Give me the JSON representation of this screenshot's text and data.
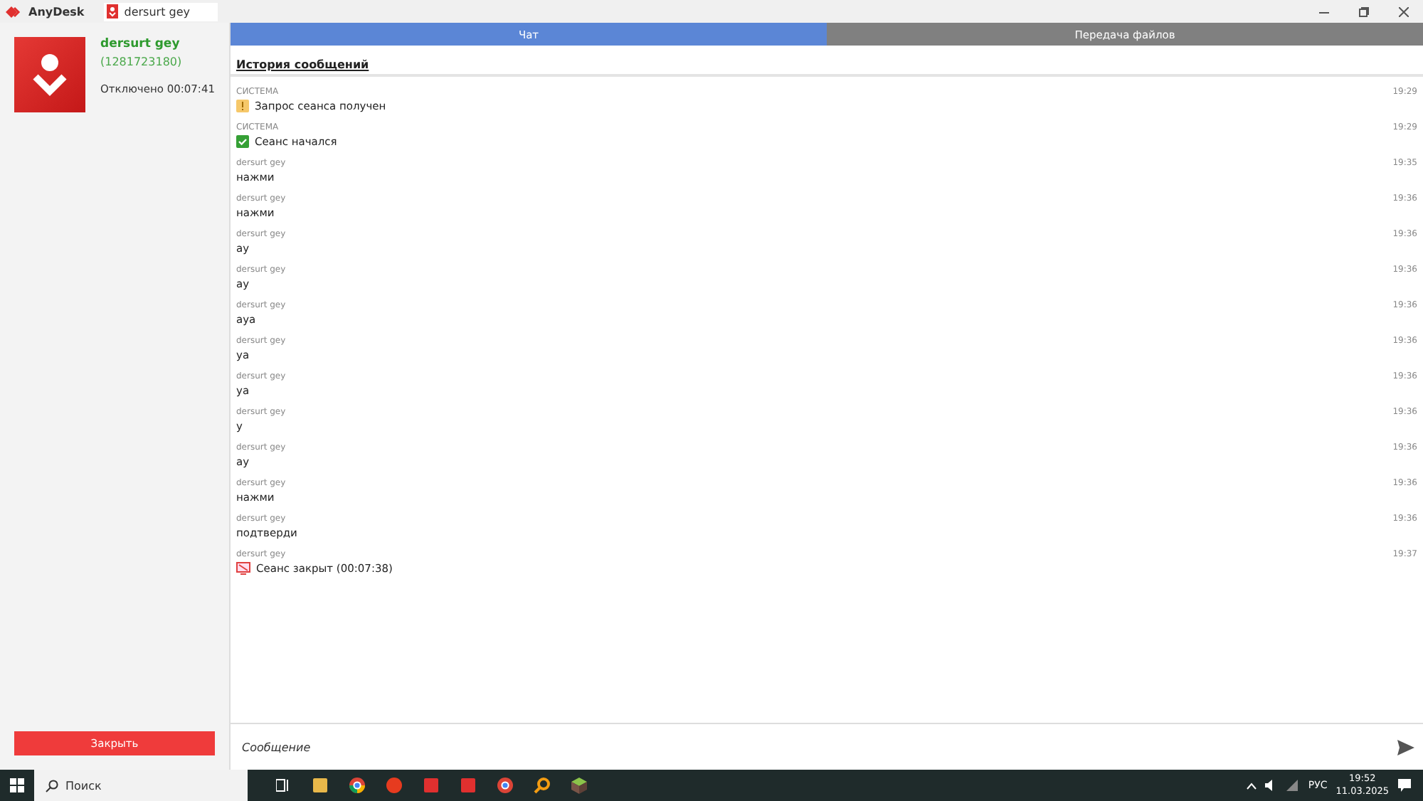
{
  "app": {
    "name": "AnyDesk",
    "session_tab": "dersurt gey"
  },
  "contact": {
    "name": "dersurt gey",
    "id": "(1281723180)",
    "status": "Отключено 00:07:41",
    "close_button": "Закрыть"
  },
  "tabs": [
    {
      "label": "Чат",
      "selected": true
    },
    {
      "label": "Передача файлов",
      "selected": false
    }
  ],
  "history_title": "История сообщений",
  "messages": [
    {
      "sender": "СИСТЕМА",
      "time": "19:29",
      "text": "Запрос сеанса получен",
      "kind": "request"
    },
    {
      "sender": "СИСТЕМА",
      "time": "19:29",
      "text": "Сеанс начался",
      "kind": "started"
    },
    {
      "sender": "dersurt gey",
      "time": "19:35",
      "text": "нажми",
      "kind": "text"
    },
    {
      "sender": "dersurt gey",
      "time": "19:36",
      "text": "нажми",
      "kind": "text"
    },
    {
      "sender": "dersurt gey",
      "time": "19:36",
      "text": "ау",
      "kind": "text"
    },
    {
      "sender": "dersurt gey",
      "time": "19:36",
      "text": "ау",
      "kind": "text"
    },
    {
      "sender": "dersurt gey",
      "time": "19:36",
      "text": "ауа",
      "kind": "text"
    },
    {
      "sender": "dersurt gey",
      "time": "19:36",
      "text": "уа",
      "kind": "text"
    },
    {
      "sender": "dersurt gey",
      "time": "19:36",
      "text": "уа",
      "kind": "text"
    },
    {
      "sender": "dersurt gey",
      "time": "19:36",
      "text": "у",
      "kind": "text"
    },
    {
      "sender": "dersurt gey",
      "time": "19:36",
      "text": "ау",
      "kind": "text"
    },
    {
      "sender": "dersurt gey",
      "time": "19:36",
      "text": "нажми",
      "kind": "text"
    },
    {
      "sender": "dersurt gey",
      "time": "19:36",
      "text": "подтверди",
      "kind": "text"
    },
    {
      "sender": "dersurt gey",
      "time": "19:37",
      "text": "Сеанс закрыт (00:07:38)",
      "kind": "closed"
    }
  ],
  "message_input": {
    "placeholder": "Сообщение"
  },
  "taskbar": {
    "search_placeholder": "Поиск",
    "language": "РУС",
    "time": "19:52",
    "date": "11.03.2025"
  }
}
